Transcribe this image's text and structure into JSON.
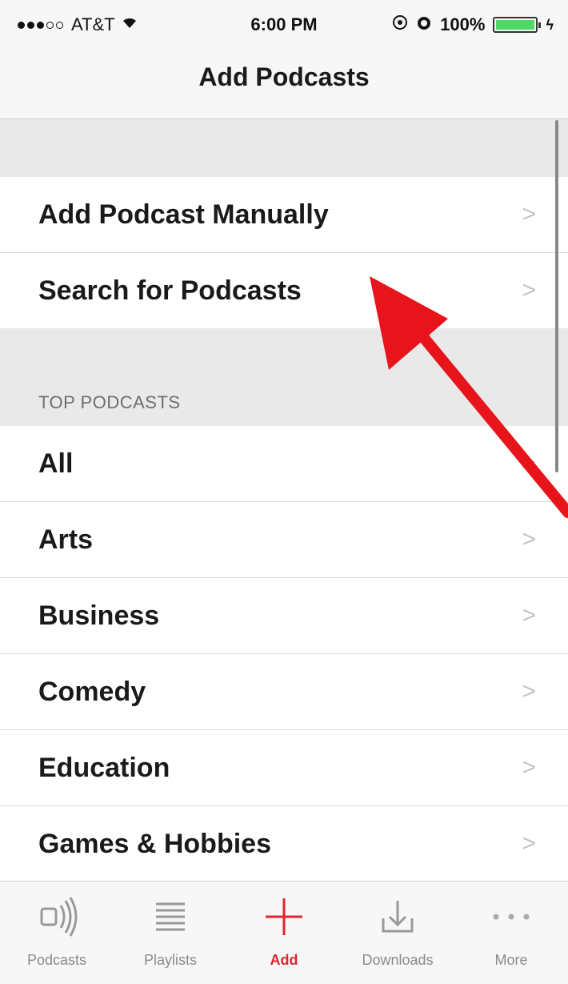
{
  "status_bar": {
    "carrier": "AT&T",
    "time": "6:00 PM",
    "battery": "100%",
    "battery_level": 1.0
  },
  "nav": {
    "title": "Add Podcasts"
  },
  "add_rows": [
    {
      "label": "Add Podcast Manually"
    },
    {
      "label": "Search for Podcasts"
    }
  ],
  "top_podcasts": {
    "header": "TOP PODCASTS",
    "rows": [
      {
        "label": "All"
      },
      {
        "label": "Arts"
      },
      {
        "label": "Business"
      },
      {
        "label": "Comedy"
      },
      {
        "label": "Education"
      },
      {
        "label": "Games & Hobbies"
      }
    ]
  },
  "tabbar": {
    "tabs": [
      {
        "label": "Podcasts",
        "icon": "podcasts-icon"
      },
      {
        "label": "Playlists",
        "icon": "list-icon"
      },
      {
        "label": "Add",
        "icon": "plus-icon",
        "active": true
      },
      {
        "label": "Downloads",
        "icon": "download-icon"
      },
      {
        "label": "More",
        "icon": "more-dots-icon"
      }
    ]
  },
  "colors": {
    "accent": "#e0262e",
    "annotation": "#e8141b",
    "battery": "#4cd964"
  }
}
